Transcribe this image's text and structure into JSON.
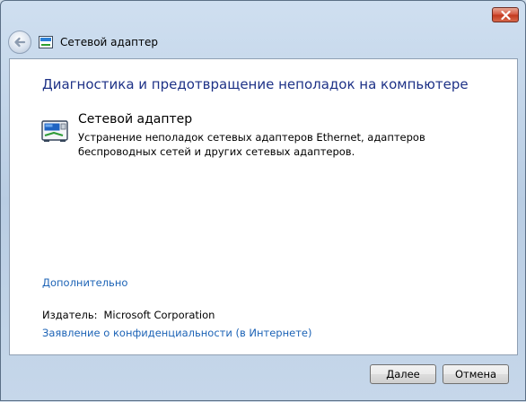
{
  "window": {
    "title": "Сетевой адаптер",
    "close_icon": "close-icon",
    "back_icon": "back-arrow-icon"
  },
  "main": {
    "heading": "Диагностика и предотвращение неполадок на компьютере",
    "item": {
      "icon": "network-adapter-icon",
      "title": "Сетевой адаптер",
      "description": "Устранение неполадок сетевых адаптеров Ethernet, адаптеров беспроводных сетей и других сетевых адаптеров."
    },
    "advanced_link": "Дополнительно",
    "publisher_label": "Издатель:",
    "publisher_value": "Microsoft Corporation",
    "privacy_link": "Заявление о конфиденциальности (в Интернете)"
  },
  "buttons": {
    "next": "Далее",
    "cancel": "Отмена"
  },
  "colors": {
    "heading": "#1e3287",
    "link": "#1c63b6",
    "close": "#c2371d"
  }
}
